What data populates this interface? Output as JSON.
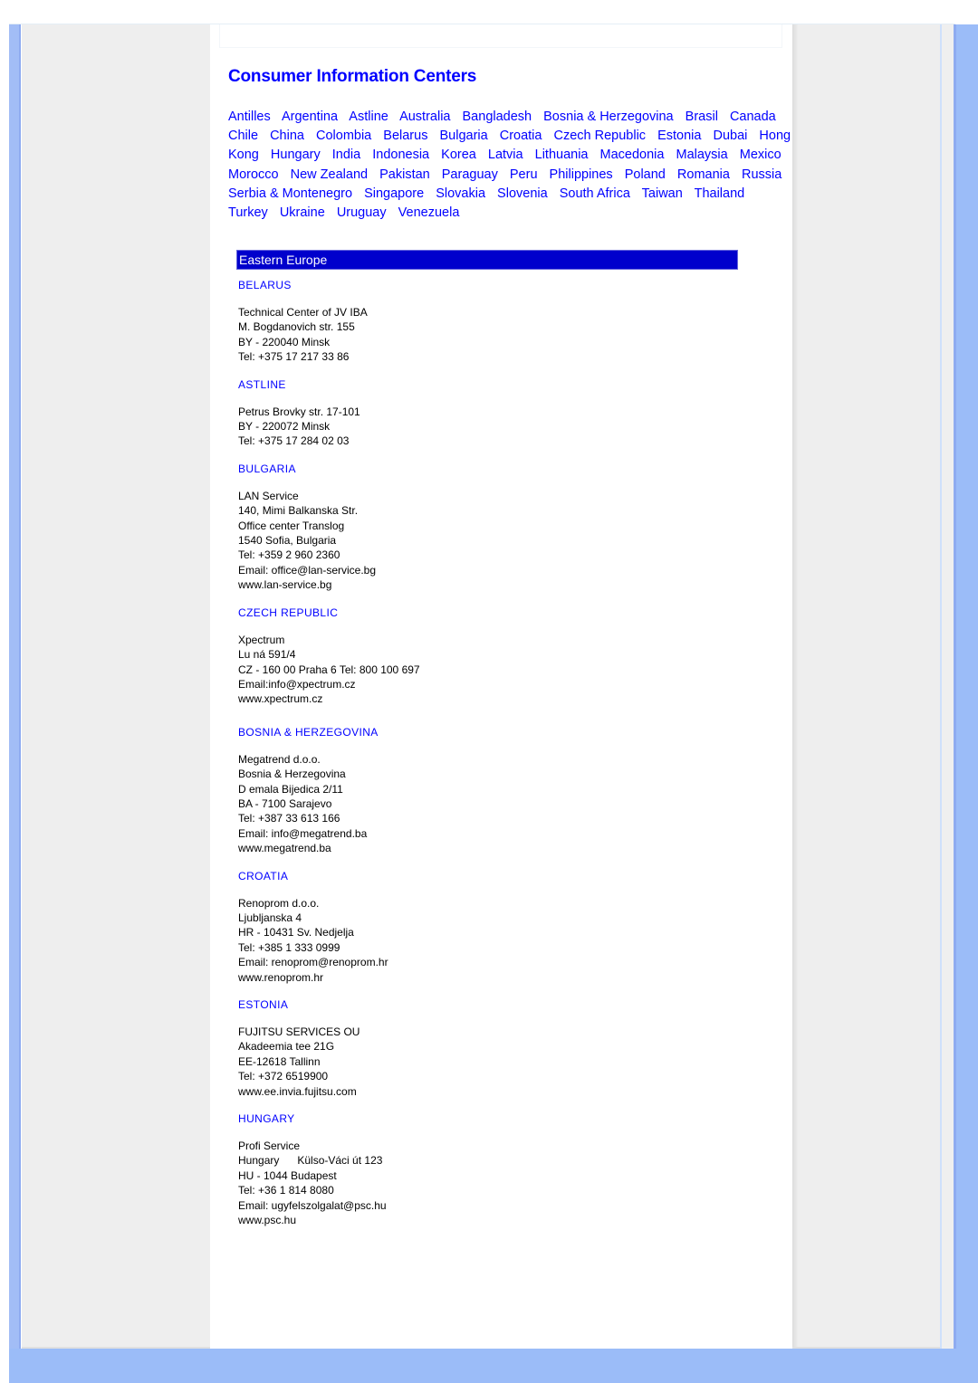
{
  "page": {
    "title": "Consumer Information Centers",
    "country_links": [
      "Antilles",
      "Argentina",
      "Astline",
      "Australia",
      "Bangladesh",
      "Bosnia & Herzegovina",
      "Brasil",
      "Canada",
      "Chile",
      "China",
      "Colombia",
      "Belarus",
      "Bulgaria",
      "Croatia",
      "Czech Republic",
      "Estonia",
      "Dubai",
      "Hong Kong",
      "Hungary",
      "India",
      "Indonesia",
      "Korea",
      "Latvia",
      "Lithuania",
      "Macedonia",
      "Malaysia",
      "Mexico",
      "Morocco",
      "New Zealand",
      "Pakistan",
      "Paraguay",
      "Peru",
      "Philippines",
      "Poland",
      "Romania",
      "Russia",
      "Serbia & Montenegro",
      "Singapore",
      "Slovakia",
      "Slovenia",
      "South Africa",
      "Taiwan",
      "Thailand",
      "Turkey",
      "Ukraine",
      "Uruguay",
      "Venezuela"
    ],
    "region": "Eastern Europe",
    "entries": [
      {
        "heading": "BELARUS",
        "lines": [
          "Technical Center of JV IBA",
          "M. Bogdanovich str. 155",
          "BY - 220040 Minsk",
          "Tel: +375 17 217 33 86"
        ]
      },
      {
        "heading": "ASTLINE",
        "lines": [
          "Petrus Brovky str. 17-101",
          "BY - 220072 Minsk",
          "Tel: +375 17 284 02 03"
        ]
      },
      {
        "heading": "BULGARIA",
        "lines": [
          "LAN Service",
          "140, Mimi Balkanska Str.",
          "Office center Translog",
          "1540 Sofia, Bulgaria",
          "Tel: +359 2 960 2360",
          "Email: office@lan-service.bg",
          "www.lan-service.bg"
        ]
      },
      {
        "heading": "CZECH REPUBLIC",
        "lines": [
          "Xpectrum",
          "Lu ná 591/4",
          "CZ - 160 00 Praha 6 Tel: 800 100 697",
          "Email:info@xpectrum.cz",
          "www.xpectrum.cz"
        ]
      },
      {
        "heading": "BOSNIA & HERZEGOVINA",
        "lines": [
          "Megatrend d.o.o.",
          "Bosnia & Herzegovina",
          "D emala Bijedica 2/11",
          "BA - 7100 Sarajevo",
          "Tel: +387 33 613 166",
          "Email: info@megatrend.ba",
          "www.megatrend.ba"
        ]
      },
      {
        "heading": "CROATIA",
        "lines": [
          "Renoprom d.o.o.",
          "Ljubljanska 4",
          "HR - 10431 Sv. Nedjelja",
          "Tel: +385 1 333 0999",
          "Email: renoprom@renoprom.hr",
          "www.renoprom.hr"
        ]
      },
      {
        "heading": "ESTONIA",
        "lines": [
          "FUJITSU SERVICES OU",
          "Akadeemia tee 21G",
          "EE-12618 Tallinn",
          "Tel: +372 6519900",
          "www.ee.invia.fujitsu.com"
        ]
      },
      {
        "heading": "HUNGARY",
        "lines": [
          "Profi Service",
          "Hungary      Külso-Váci út 123",
          "HU - 1044 Budapest",
          "Tel: +36 1 814 8080",
          "Email: ugyfelszolgalat@psc.hu",
          "www.psc.hu"
        ]
      }
    ]
  },
  "colors": {
    "link": "#0000ff",
    "region_bar": "#0000cc",
    "frame_blue": "#9bbcf8",
    "frame_gray": "#eeeeee"
  }
}
